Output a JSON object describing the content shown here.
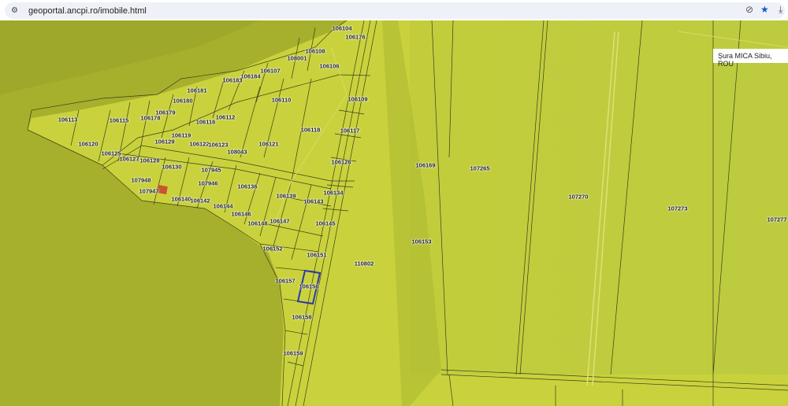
{
  "browser": {
    "url": "geoportal.ancpi.ro/imobile.html",
    "icons": [
      "site-settings-icon",
      "eye-off-icon",
      "bookmark-star-icon",
      "download-icon"
    ],
    "accent": "#1a56d6"
  },
  "map": {
    "location_label": "Șura MICA Sibiu, ROU",
    "highlight_color": "#2a3aa8",
    "building_color": "#c8552e",
    "parcels": [
      "106104",
      "106176",
      "106108",
      "108001",
      "106106",
      "106107",
      "106184",
      "106183",
      "106181",
      "106180",
      "106109",
      "106110",
      "106179",
      "106112",
      "106113",
      "106115",
      "106178",
      "106116",
      "106118",
      "106117",
      "106119",
      "106129",
      "106122",
      "106123",
      "106121",
      "106120",
      "108043",
      "106125",
      "106127",
      "106128",
      "106126",
      "106130",
      "107945",
      "106169",
      "107265",
      "107948",
      "107946",
      "106136",
      "106139",
      "106134",
      "107947",
      "106140",
      "106142",
      "106143",
      "107270",
      "107273",
      "107277",
      "106144",
      "106146",
      "106148",
      "106147",
      "106145",
      "106153",
      "106152",
      "106151",
      "110802",
      "106157",
      "106156",
      "106158",
      "106159"
    ]
  }
}
